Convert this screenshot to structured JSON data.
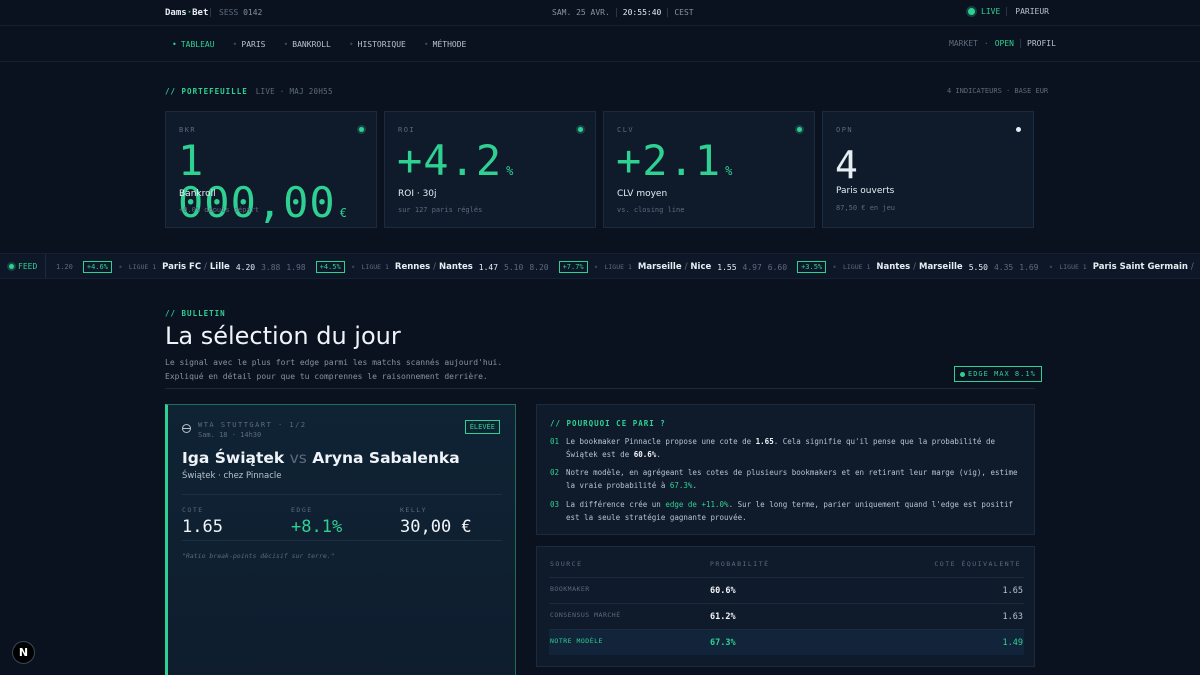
{
  "topbar": {
    "brand_a": "Dams",
    "brand_sep": "·",
    "brand_b": "Bet",
    "sess_label": "SESS",
    "sess_id": "0142",
    "date": "SAM. 25 AVR.",
    "time": "20:55:40",
    "tz": "CEST",
    "live": "LIVE",
    "user": "PARIEUR"
  },
  "nav": {
    "items": [
      "TABLEAU",
      "PARIS",
      "BANKROLL",
      "HISTORIQUE",
      "MÉTHODE"
    ],
    "market_label": "MARKET",
    "market_dot": "·",
    "market_status": "OPEN",
    "profile": "PROFIL"
  },
  "portfolio": {
    "title": "// PORTEFEUILLE",
    "sub": "LIVE · MAJ 20H55",
    "right": "4 INDICATEURS · BASE EUR",
    "cards": [
      {
        "code": "BKR",
        "value": "1 000,00",
        "unit": "€",
        "label": "Bankroll",
        "sub": "+0.0% depuis départ"
      },
      {
        "code": "ROI",
        "value": "+4.2",
        "unit": "%",
        "label": "ROI · 30j",
        "sub": "sur 127 paris réglés"
      },
      {
        "code": "CLV",
        "value": "+2.1",
        "unit": "%",
        "label": "CLV moyen",
        "sub": "vs. closing line"
      },
      {
        "code": "OPN",
        "value": "4",
        "unit": "",
        "label": "Paris ouverts",
        "sub": "87,50 € en jeu"
      }
    ]
  },
  "ticker": {
    "feed": "FEED",
    "lead_odd": "1.20",
    "items": [
      {
        "badge": "+4.6%",
        "league": "LIGUE 1",
        "home": "Paris FC",
        "away": "Lille",
        "o1": "4.20",
        "o2": "3.88",
        "o3": "1.98"
      },
      {
        "badge": "+4.5%",
        "league": "LIGUE 1",
        "home": "Rennes",
        "away": "Nantes",
        "o1": "1.47",
        "o2": "5.10",
        "o3": "8.20"
      },
      {
        "badge": "+7.7%",
        "league": "LIGUE 1",
        "home": "Marseille",
        "away": "Nice",
        "o1": "1.55",
        "o2": "4.97",
        "o3": "6.60"
      },
      {
        "badge": "+3.5%",
        "league": "LIGUE 1",
        "home": "Nantes",
        "away": "Marseille",
        "o1": "5.50",
        "o2": "4.35",
        "o3": "1.69"
      },
      {
        "badge": "",
        "league": "LIGUE 1",
        "home": "Paris Saint Germain",
        "away": "",
        "o1": "",
        "o2": "",
        "o3": ""
      }
    ]
  },
  "bulletin": {
    "tag": "// BULLETIN",
    "title": "La sélection du jour",
    "desc": "Le signal avec le plus fort edge parmi les matchs scannés aujourd'hui. Expliqué en détail pour que tu comprennes le raisonnement derrière.",
    "edge_max": "EDGE MAX 8.1%"
  },
  "pick": {
    "competition": "WTA STUTTGART · 1/2",
    "date": "Sam. 18 · 14h30",
    "level": "ÉLEVÉE",
    "player_a": "Iga Świątek",
    "vs": "vs",
    "player_b": "Aryna Sabalenka",
    "selection": "Świątek · chez Pinnacle",
    "stats": [
      {
        "k": "COTE",
        "v": "1.65"
      },
      {
        "k": "EDGE",
        "v": "+8.1%"
      },
      {
        "k": "KELLY",
        "v": "30,00 €"
      }
    ],
    "note": "\"Ratio break-points décisif sur terre.\""
  },
  "why": {
    "title": "// POURQUOI CE PARI ?",
    "r1": {
      "n": "01",
      "a": "Le bookmaker Pinnacle propose une cote de ",
      "b": "1.65",
      "c": ". Cela signifie qu'il pense que la probabilité de Świątek est de ",
      "d": "60.6%",
      "e": "."
    },
    "r2": {
      "n": "02",
      "a": "Notre modèle, en agrégeant les cotes de plusieurs bookmakers et en retirant leur marge (vig), estime la vraie probabilité à ",
      "b": "67.3%",
      "c": "."
    },
    "r3": {
      "n": "03",
      "a": "La différence crée un ",
      "b": "edge de +11.0%",
      "c": ". Sur le long terme, parier uniquement quand l'edge est positif est la seule stratégie gagnante prouvée."
    }
  },
  "prob": {
    "headers": [
      "SOURCE",
      "PROBABILITÉ",
      "COTE ÉQUIVALENTE"
    ],
    "rows": [
      {
        "source": "BOOKMAKER",
        "p": "60.6%",
        "cote": "1.65"
      },
      {
        "source": "CONSENSUS MARCHÉ",
        "p": "61.2%",
        "cote": "1.63"
      },
      {
        "source": "NOTRE MODÈLE",
        "p": "67.3%",
        "cote": "1.49"
      }
    ]
  },
  "badge": "N"
}
